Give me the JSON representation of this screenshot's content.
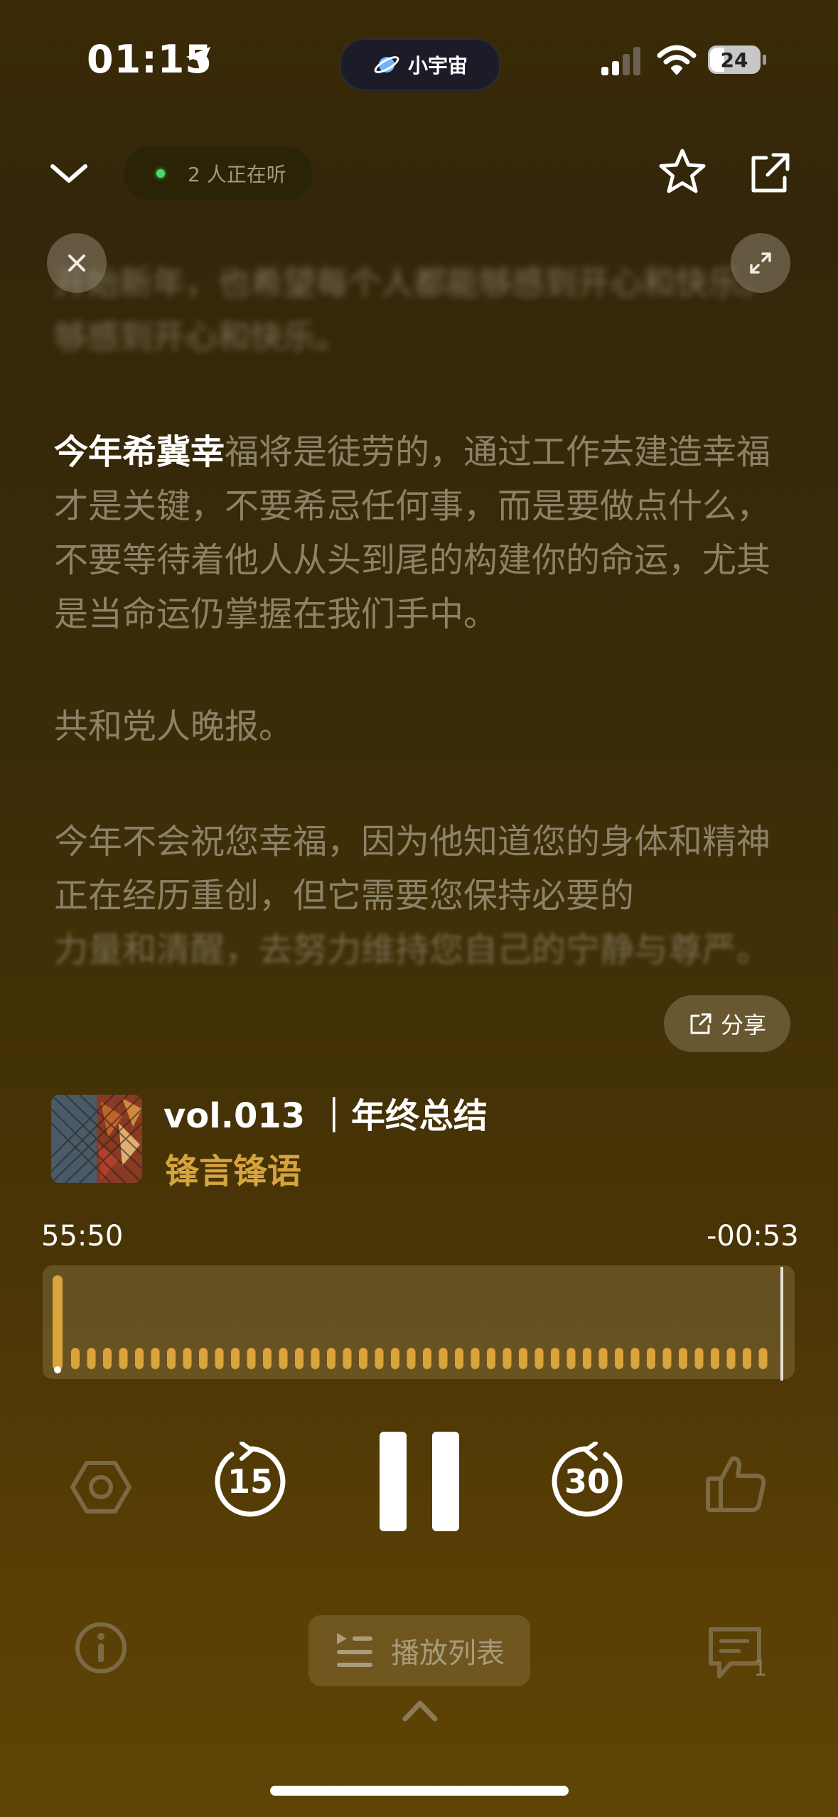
{
  "status_bar": {
    "time": "01:15",
    "island_label": "小宇宙",
    "battery": "24"
  },
  "header": {
    "listening": "2 人正在听"
  },
  "transcript": {
    "blurred_top": "开始新年，也希望每个人都能够感到开心和快乐。",
    "blurred_top_2": "够感到开心和快乐。",
    "p1_highlight": "今年希冀幸",
    "p1_rest": "福将是徒劳的，通过工作去建造幸福才是关键，不要希忌任何事，而是要做点什么，不要等待着他人从头到尾的构建你的命运，尤其是当命运仍掌握在我们手中。",
    "p2": "共和党人晚报。",
    "p3": "今年不会祝您幸福，因为他知道您的身体和精神正在经历重创，但它需要您保持必要的",
    "p3_blur": "力量和清醒，去努力维持您自己的宁静与尊严。",
    "share_label": "分享"
  },
  "episode": {
    "title": "vol.013 ｜年终总结",
    "show": "锋言锋语"
  },
  "progress": {
    "elapsed": "55:50",
    "remaining": "-00:53",
    "fraction": 0.98
  },
  "controls": {
    "rewind_seconds": "15",
    "forward_seconds": "30"
  },
  "bottom": {
    "playlist_label": "播放列表",
    "comment_count": "1"
  },
  "colors": {
    "accent": "#d7a43c",
    "live_dot": "#4cd964"
  }
}
